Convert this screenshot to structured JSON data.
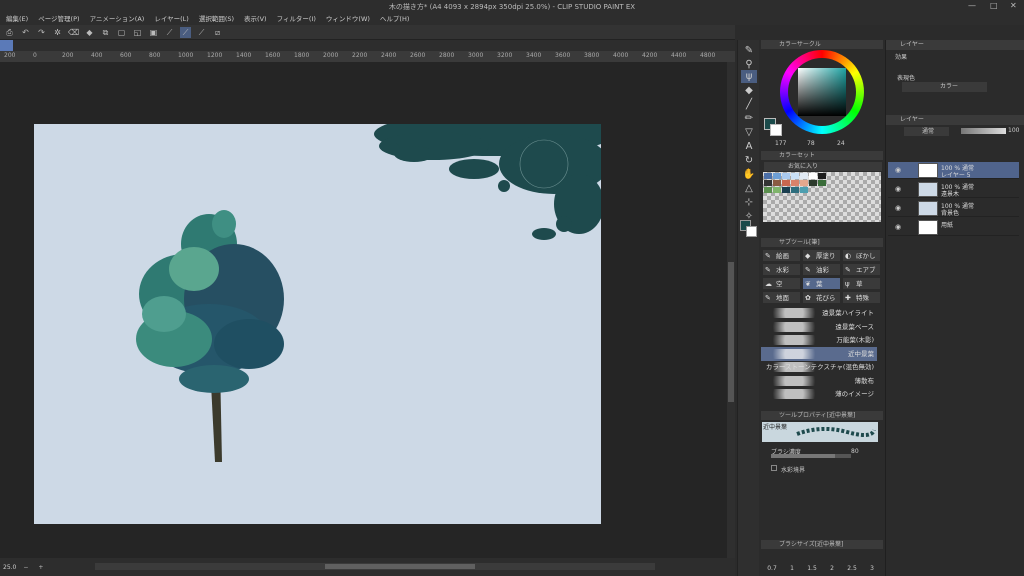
{
  "window": {
    "title": "木の描き方* (A4 4093 x 2894px 350dpi 25.0%) - CLIP STUDIO PAINT EX",
    "controls": [
      "—",
      "□",
      "✕"
    ]
  },
  "menu": [
    "編集(E)",
    "ページ管理(P)",
    "アニメーション(A)",
    "レイヤー(L)",
    "選択範囲(S)",
    "表示(V)",
    "フィルター(I)",
    "ウィンドウ(W)",
    "ヘルプ(H)"
  ],
  "ruler": [
    "200",
    "0",
    "200",
    "400",
    "600",
    "800",
    "1000",
    "1200",
    "1400",
    "1600",
    "1800",
    "2000",
    "2200",
    "2400",
    "2600",
    "2800",
    "3000",
    "3200",
    "3400",
    "3600",
    "3800",
    "4000",
    "4200",
    "4400",
    "4800"
  ],
  "status": {
    "zoom": "25.0"
  },
  "color_panel": {
    "header": "カラーサークル",
    "readout": [
      "177",
      "78",
      "24"
    ],
    "main_color": "#1b4a4a",
    "sub_color": "#ffffff"
  },
  "color_set": {
    "header": "カラーセット",
    "dropdown": "お気に入り",
    "swatches": [
      "#4b6fa8",
      "#6d9fd6",
      "#a9c9ee",
      "#c9dff5",
      "#e0e9f3",
      "#ffffff",
      "#1d1d1d",
      "#333",
      "#8a5b42",
      "#c8674f",
      "#d9826a",
      "#e5a88e",
      "#2c3a2c",
      "#3a6d3a",
      "#5a8f4e",
      "#7fb46b",
      "#1b3f50",
      "#2d6d7d",
      "#4e9fb0"
    ]
  },
  "subtool_panel": {
    "header": "サブツール[筆]",
    "groups": [
      {
        "icon": "✎",
        "label": "絵画"
      },
      {
        "icon": "◆",
        "label": "厚塗り"
      },
      {
        "icon": "◐",
        "label": "ぼかし"
      },
      {
        "icon": "✎",
        "label": "水彩"
      },
      {
        "icon": "✎",
        "label": "油彩"
      },
      {
        "icon": "✎",
        "label": "エアブラシ"
      },
      {
        "icon": "☁",
        "label": "空"
      },
      {
        "icon": "❦",
        "label": "葉"
      },
      {
        "icon": "ψ",
        "label": "草"
      },
      {
        "icon": "✎",
        "label": "地面"
      },
      {
        "icon": "✿",
        "label": "花びら"
      },
      {
        "icon": "✚",
        "label": "特殊"
      }
    ],
    "brushes": [
      "遠景葉ハイライト",
      "遠景葉ベース",
      "万能葉(木影)",
      "近中景葉",
      "カラーストーンテクスチャ(混色無効)",
      "薄散布",
      "薄のイメージ"
    ]
  },
  "tool_property": {
    "header": "ツールプロパティ[近中景葉]",
    "brush_name": "近中景葉",
    "density_label": "ブラシ濃度",
    "density_value": "80",
    "watercolor_label": "水彩境界"
  },
  "brush_size": {
    "header": "ブラシサイズ[近中景葉]",
    "sizes": [
      "0.7",
      "1",
      "1.5",
      "2",
      "2.5",
      "3"
    ]
  },
  "layer_panel": {
    "tab": "レイヤー",
    "effect_label": "効果",
    "expression_label": "表現色",
    "expression_value": "カラー",
    "blend_mode": "通常",
    "opacity": "100",
    "layers": [
      {
        "line1": "100 % 通常",
        "line2": "レイヤー 5"
      },
      {
        "line1": "100 % 通常",
        "line2": "遠景木"
      },
      {
        "line1": "100 % 通常",
        "line2": "背景色"
      },
      {
        "line1": "用紙",
        "line2": ""
      }
    ]
  }
}
